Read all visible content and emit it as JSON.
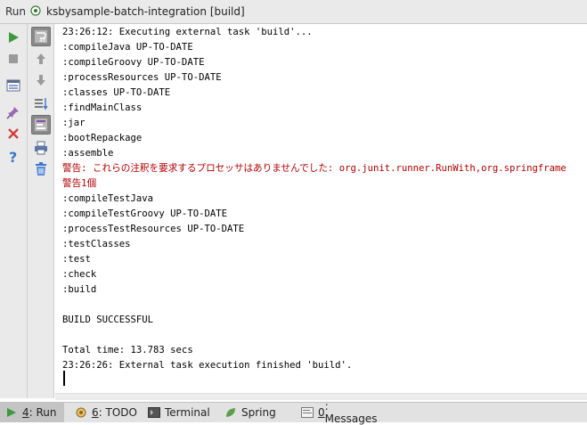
{
  "titlebar": {
    "label": "Run",
    "config_name": "ksbysample-batch-integration [build]"
  },
  "console": {
    "lines": [
      {
        "text": "23:26:12: Executing external task 'build'...",
        "kind": "normal"
      },
      {
        "text": ":compileJava UP-TO-DATE",
        "kind": "normal"
      },
      {
        "text": ":compileGroovy UP-TO-DATE",
        "kind": "normal"
      },
      {
        "text": ":processResources UP-TO-DATE",
        "kind": "normal"
      },
      {
        "text": ":classes UP-TO-DATE",
        "kind": "normal"
      },
      {
        "text": ":findMainClass",
        "kind": "normal"
      },
      {
        "text": ":jar",
        "kind": "normal"
      },
      {
        "text": ":bootRepackage",
        "kind": "normal"
      },
      {
        "text": ":assemble",
        "kind": "normal"
      },
      {
        "text": "警告: これらの注釈を要求するプロセッサはありませんでした: org.junit.runner.RunWith,org.springframe",
        "kind": "warn"
      },
      {
        "text": "警告1個",
        "kind": "warn"
      },
      {
        "text": ":compileTestJava",
        "kind": "normal"
      },
      {
        "text": ":compileTestGroovy UP-TO-DATE",
        "kind": "normal"
      },
      {
        "text": ":processTestResources UP-TO-DATE",
        "kind": "normal"
      },
      {
        "text": ":testClasses",
        "kind": "normal"
      },
      {
        "text": ":test",
        "kind": "normal"
      },
      {
        "text": ":check",
        "kind": "normal"
      },
      {
        "text": ":build",
        "kind": "normal"
      },
      {
        "text": "",
        "kind": "normal"
      },
      {
        "text": "BUILD SUCCESSFUL",
        "kind": "normal"
      },
      {
        "text": "",
        "kind": "normal"
      },
      {
        "text": "Total time: 13.783 secs",
        "kind": "normal"
      },
      {
        "text": "23:26:26: External task execution finished 'build'.",
        "kind": "normal"
      }
    ]
  },
  "bottom_tabs": [
    {
      "num": "4",
      "label": ": Run",
      "icon": "run-icon",
      "active": true
    },
    {
      "num": "6",
      "label": ": TODO",
      "icon": "todo-icon",
      "active": false
    },
    {
      "num": "",
      "label": "Terminal",
      "icon": "terminal-icon",
      "active": false
    },
    {
      "num": "",
      "label": "Spring",
      "icon": "spring-icon",
      "active": false
    },
    {
      "num": "0",
      "label": ": Messages",
      "icon": "messages-icon",
      "active": false
    }
  ],
  "colors": {
    "warning_text": "#b00000",
    "run_green": "#3c9a3c"
  }
}
